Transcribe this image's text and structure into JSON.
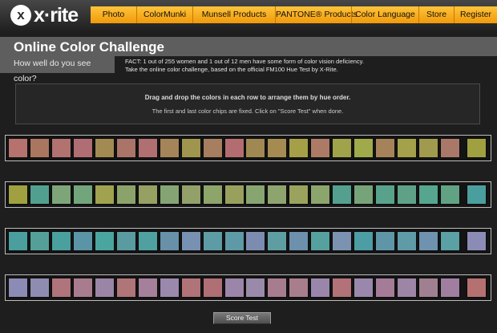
{
  "brand": {
    "logo_letter": "x",
    "name": "x·rite"
  },
  "nav": {
    "items": [
      "Photo",
      "ColorMunki",
      "Munsell Products",
      "PANTONE® Products",
      "Color Language",
      "Store",
      "Register"
    ]
  },
  "header": {
    "title": "Online Color Challenge",
    "subtitle": "How well do you see color?",
    "fact_line1": "FACT: 1 out of 255 women and 1 out of 12 men have some form of color vision deficiency.",
    "fact_line2": "Take the online color challenge, based on the official FM100 Hue Test by X-Rite."
  },
  "instructions": {
    "main": "Drag and drop the colors in each row to arrange them by hue order.",
    "sub": "The first and last color chips are fixed. Click on \"Score Test\" when done."
  },
  "rows": [
    [
      "#b5726e",
      "#ab7660",
      "#b17270",
      "#b06e74",
      "#a28a52",
      "#ab7468",
      "#b06f70",
      "#a5845a",
      "#a0954e",
      "#a77e60",
      "#b36d70",
      "#a08852",
      "#a58a52",
      "#a5a047",
      "#ad7a66",
      "#a0a34a",
      "#a0aa4a",
      "#a6825a",
      "#a3a14a",
      "#a09a4e",
      "#aa7869",
      "#a0a040"
    ],
    [
      "#a0a040",
      "#51a08f",
      "#7ea57a",
      "#73a57d",
      "#a0a24f",
      "#8ca26b",
      "#96a062",
      "#85a474",
      "#93a069",
      "#8da46b",
      "#99a05e",
      "#87a571",
      "#8ea46f",
      "#9aa25d",
      "#8ba56c",
      "#53a08f",
      "#76a478",
      "#58a28b",
      "#5fa187",
      "#56a58f",
      "#60a283",
      "#4a9e9e"
    ],
    [
      "#4a9e9e",
      "#54a098",
      "#4aa09e",
      "#5a94a6",
      "#4aa5a0",
      "#5a9ba1",
      "#50a0a2",
      "#6890a8",
      "#7890b2",
      "#5d9ca4",
      "#5e99a7",
      "#7b8cb0",
      "#5e9ea2",
      "#6d90ac",
      "#56a0a0",
      "#7b93b0",
      "#4c9ea4",
      "#5e96a8",
      "#5e9ba7",
      "#6f92b0",
      "#5aa0a5",
      "#8b8bb5"
    ],
    [
      "#8b8bb5",
      "#8f8cb2",
      "#b0747c",
      "#a87c8c",
      "#9a85a6",
      "#b07578",
      "#a4809a",
      "#9a88ad",
      "#b07378",
      "#b06f74",
      "#9b85a8",
      "#9a8aaa",
      "#a77c8e",
      "#a87e8c",
      "#9b86ab",
      "#b27277",
      "#9a88ac",
      "#a47c98",
      "#9d85a5",
      "#a08090",
      "#a07ea0",
      "#b57170"
    ]
  ],
  "actions": {
    "score_label": "Score Test"
  }
}
